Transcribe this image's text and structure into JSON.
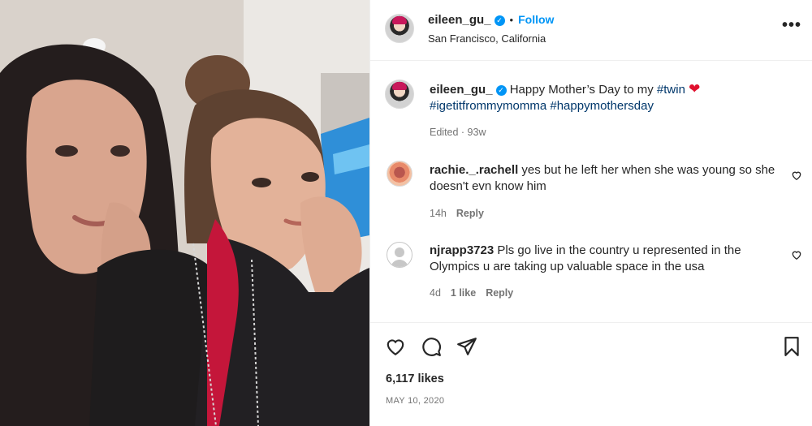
{
  "post": {
    "username": "eileen_gu_",
    "location": "San Francisco, California",
    "follow_label": "Follow",
    "separator": "•",
    "more_label": "•••"
  },
  "caption": {
    "username": "eileen_gu_",
    "text_before": "Happy Mother’s Day to my ",
    "hashtag_twin": "#twin",
    "heart": "❤",
    "hashtag_line2": "#igetitfrommymomma #happymothersday",
    "meta": "Edited · 93w"
  },
  "comments": [
    {
      "username": "rachie._.rachell",
      "text": " yes but he left her when she was young so she doesn't evn know him",
      "time": "14h",
      "likes": "",
      "reply_label": "Reply"
    },
    {
      "username": "njrapp3723",
      "text": " Pls go live in the country u represented in the Olympics u are taking up valuable space in the usa",
      "time": "4d",
      "likes": "1 like",
      "reply_label": "Reply"
    }
  ],
  "stats": {
    "likes": "6,117 likes",
    "date": "MAY 10, 2020"
  },
  "colors": {
    "accent": "#0095f6",
    "hashtag": "#00376b",
    "heart": "#e0102e",
    "muted": "#737373"
  }
}
